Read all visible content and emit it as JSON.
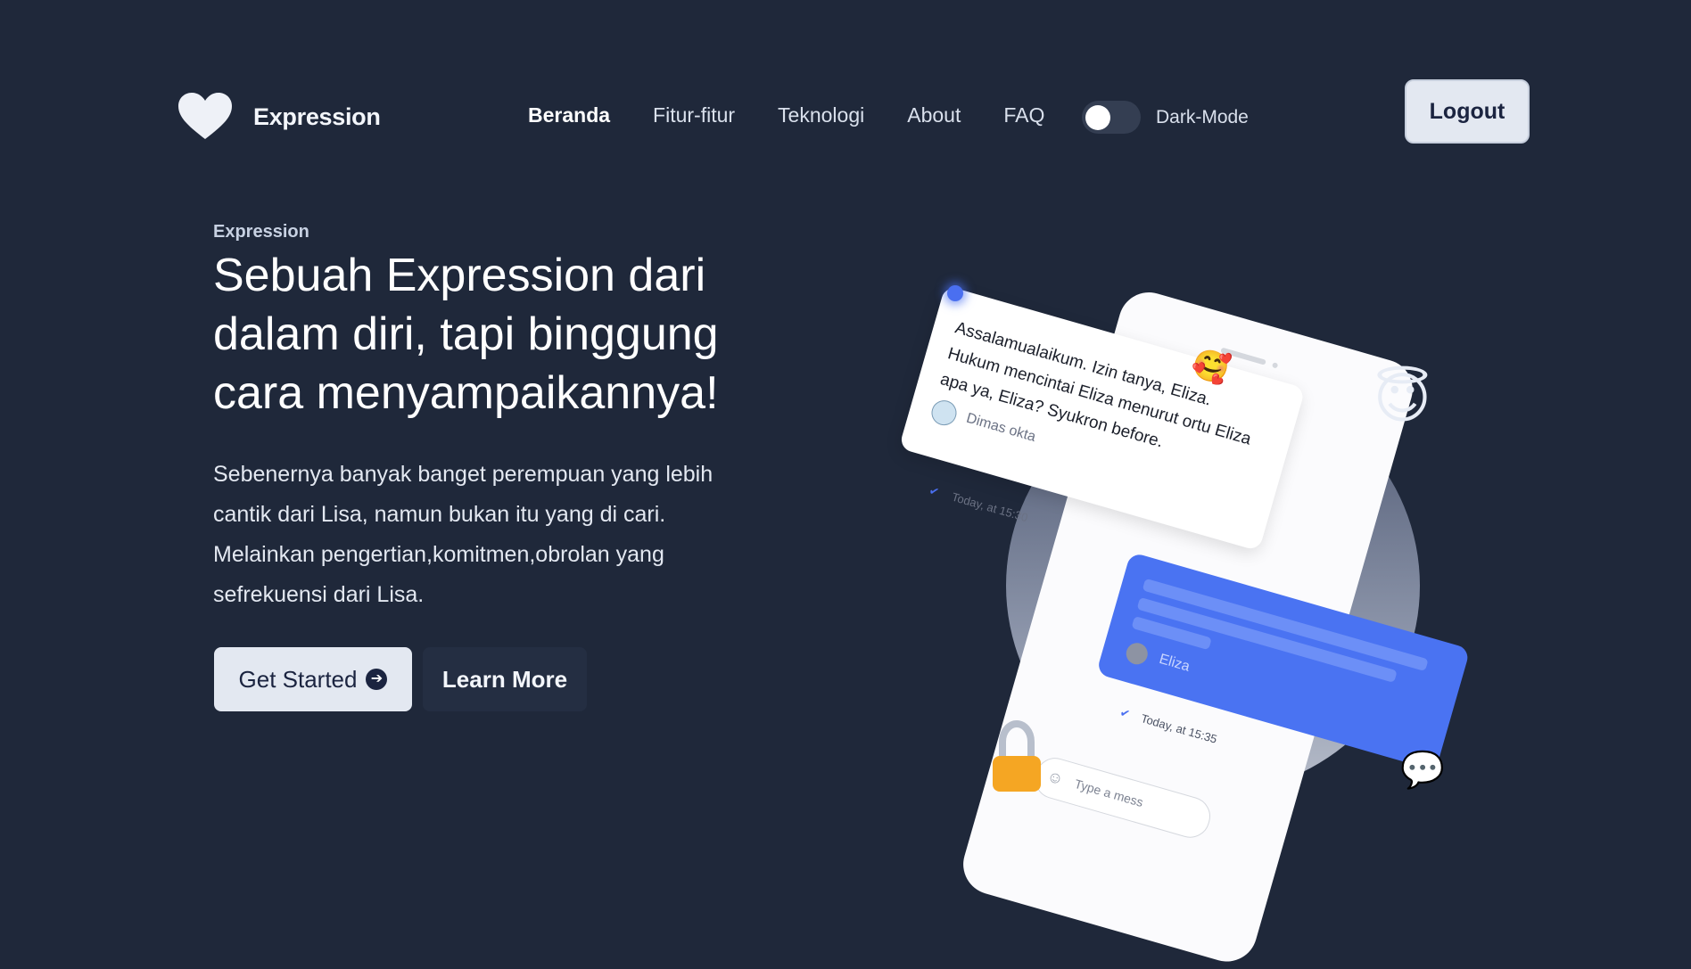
{
  "brand": {
    "name": "Expression",
    "logo": "heart-icon"
  },
  "nav": {
    "items": [
      {
        "label": "Beranda",
        "active": true
      },
      {
        "label": "Fitur-fitur",
        "active": false
      },
      {
        "label": "Teknologi",
        "active": false
      },
      {
        "label": "About",
        "active": false
      },
      {
        "label": "FAQ",
        "active": false
      }
    ],
    "dark_mode_label": "Dark-Mode",
    "dark_mode_on": false,
    "logout_label": "Logout"
  },
  "hero": {
    "eyebrow": "Expression",
    "headline_line1": "Sebuah Expression dari",
    "headline_line2": "dalam diri, tapi binggung",
    "headline_line3": "cara menyampaikannya!",
    "desc_line1": "Sebenernya banyak banget perempuan yang lebih",
    "desc_line2": "cantik dari Lisa, namun bukan itu yang di cari.",
    "desc_line3": "Melainkan pengertian,komitmen,obrolan yang",
    "desc_line4": "sefrekuensi dari Lisa.",
    "primary_button": "Get Started",
    "secondary_button": "Learn More"
  },
  "illustration": {
    "message1": {
      "text": "Assalamualaikum. Izin tanya, Eliza. Hukum mencintai Eliza menurut ortu Eliza apa ya, Eliza? Syukron before.",
      "user": "Dimas okta",
      "time": "Today, at 15:30"
    },
    "message2": {
      "user": "Eliza",
      "time": "Today, at 15:35"
    },
    "input_placeholder": "Type a mess",
    "icons": [
      "smiling-face-with-hearts-icon",
      "smiling-face-with-halo-icon",
      "lock-icon",
      "speech-balloon-icon",
      "check-icon",
      "smile-icon"
    ]
  },
  "colors": {
    "background": "#1f283a",
    "accent": "#4a73f2",
    "button_light": "#e3e8f1"
  }
}
